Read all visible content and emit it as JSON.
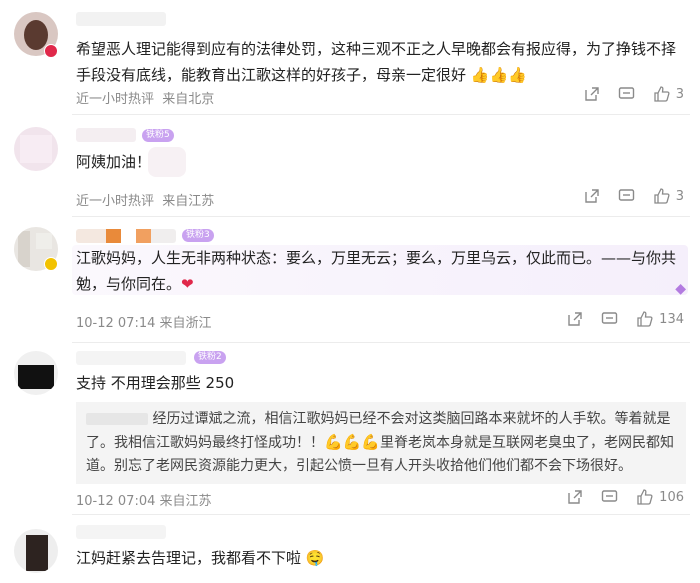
{
  "comments": [
    {
      "text": "希望恶人理记能得到应有的法律处罚，这种三观不正之人早晚都会有报应得，为了挣钱不择手段没有底线，能教育出江歌这样的好孩子，母亲一定很好",
      "emoji": "👍👍👍",
      "time": "近一小时热评",
      "location": "来自北京",
      "likes": "3"
    },
    {
      "badge": "铁粉5",
      "text": "阿姨加油！",
      "time": "近一小时热评",
      "location": "来自江苏",
      "likes": "3"
    },
    {
      "badge": "铁粉3",
      "text": "江歌妈妈，人生无非两种状态：要么，万里无云；要么，万里乌云，仅此而已。——与你共勉，与你同在。",
      "emoji": "❤",
      "time": "10-12 07:14",
      "location": "来自浙江",
      "likes": "134"
    },
    {
      "badge": "铁粉2",
      "text": "支持 不用理会那些 250",
      "reply": "经历过谭斌之流，相信江歌妈妈已经不会对这类脑回路本来就坏的人手软。等着就是了。我相信江歌妈妈最终打怪成功！！",
      "reply_emoji": "💪💪💪",
      "reply_cont": "里脊老岚本身就是互联网老臭虫了，老网民都知道。别忘了老网民资源能力更大，引起公愤一旦有人开头收拾他们他们都不会下场很好。",
      "time": "10-12 07:04",
      "location": "来自江苏",
      "likes": "106"
    },
    {
      "text": "江妈赶紧去告理记，我都看不下啦",
      "emoji": "🤤"
    }
  ],
  "colors": {
    "badge": "#c9a2f0",
    "heart": "#e0284a",
    "meta": "#8a8a8a"
  }
}
